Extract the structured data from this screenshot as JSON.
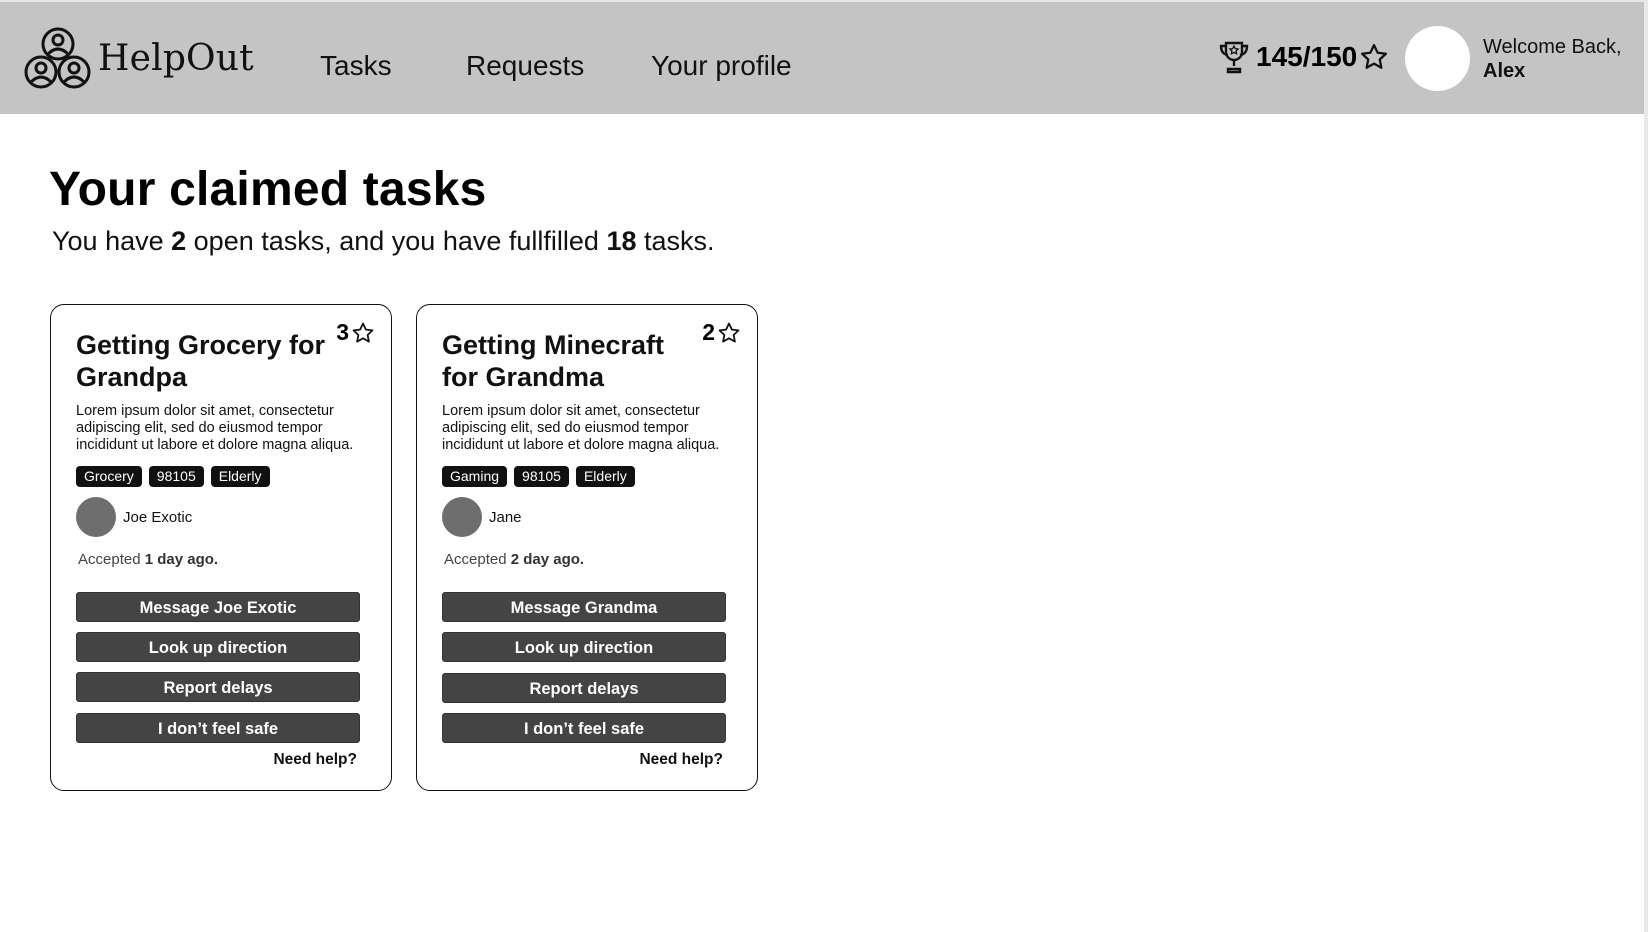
{
  "header": {
    "logo_text": "HelpOut",
    "nav": [
      {
        "label": "Tasks"
      },
      {
        "label": "Requests"
      },
      {
        "label": "Your profile"
      }
    ],
    "points": "145/150",
    "welcome_text": "Welcome Back,",
    "user_name": "Alex"
  },
  "page": {
    "title": "Your claimed tasks",
    "summary_prefix": "You have ",
    "open_count": "2",
    "summary_middle": " open tasks, and you have fullfilled ",
    "fulfilled_count": "18",
    "summary_suffix": " tasks."
  },
  "cards": [
    {
      "title": "Getting Grocery for Grandpa",
      "stars": "3",
      "description": "Lorem ipsum dolor sit amet, consectetur adipiscing elit, sed do eiusmod tempor incididunt ut labore et dolore magna aliqua.",
      "tags": [
        "Grocery",
        "98105",
        "Elderly"
      ],
      "requester": "Joe Exotic",
      "accepted_label": "Accepted ",
      "accepted_when": "1 day ago.",
      "actions": [
        "Message Joe Exotic",
        "Look up direction",
        "Report delays",
        "I don’t feel safe"
      ],
      "help": "Need help?"
    },
    {
      "title": "Getting Minecraft for Grandma",
      "stars": "2",
      "description": "Lorem ipsum dolor sit amet, consectetur adipiscing elit, sed do eiusmod tempor incididunt ut labore et dolore magna aliqua.",
      "tags": [
        "Gaming",
        "98105",
        "Elderly"
      ],
      "requester": "Jane",
      "accepted_label": "Accepted ",
      "accepted_when": "2 day ago.",
      "actions": [
        "Message Grandma",
        "Look up direction",
        "Report delays",
        "I don’t feel safe"
      ],
      "help": "Need help?"
    }
  ],
  "colors": {
    "header_bg": "#c4c4c4",
    "button_bg": "#444444",
    "tag_bg": "#111111",
    "avatar_gray": "#6e6e6e"
  },
  "icons": [
    "helpout-logo-icon",
    "trophy-icon",
    "star-icon"
  ]
}
